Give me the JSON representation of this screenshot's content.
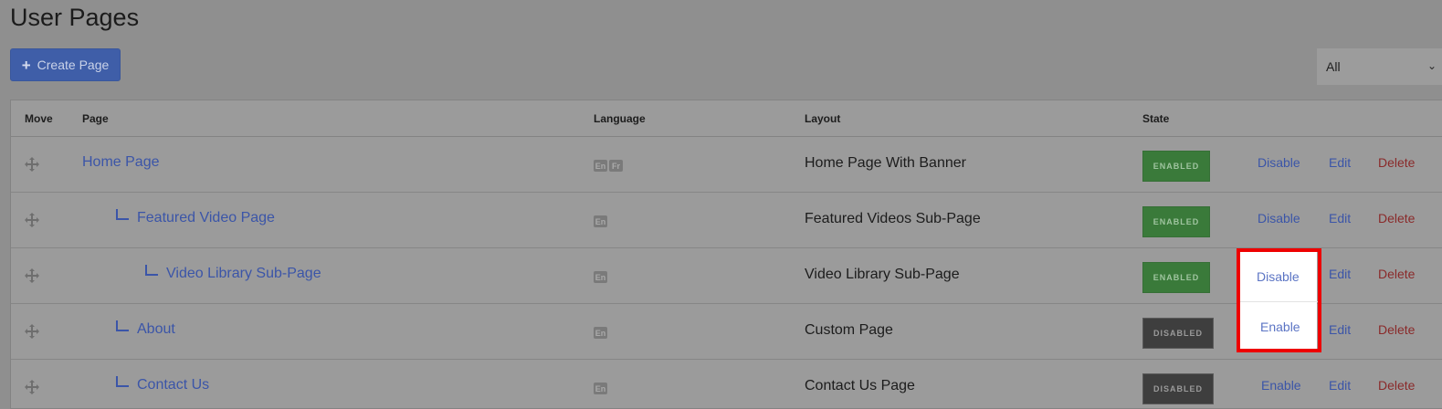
{
  "page": {
    "title": "User Pages",
    "create_button": "Create Page",
    "filter": {
      "selected": "All"
    }
  },
  "table": {
    "headers": {
      "move": "Move",
      "page": "Page",
      "language": "Language",
      "layout": "Layout",
      "state": "State"
    },
    "rows": [
      {
        "page": "Home Page",
        "languages": [
          "En",
          "Fr"
        ],
        "layout": "Home Page With Banner",
        "state": "ENABLED",
        "toggle": "Disable",
        "edit": "Edit",
        "delete": "Delete"
      },
      {
        "page": "Featured Video Page",
        "languages": [
          "En"
        ],
        "layout": "Featured Videos Sub-Page",
        "state": "ENABLED",
        "toggle": "Disable",
        "edit": "Edit",
        "delete": "Delete"
      },
      {
        "page": "Video Library Sub-Page",
        "languages": [
          "En"
        ],
        "layout": "Video Library Sub-Page",
        "state": "ENABLED",
        "toggle": "Disable",
        "edit": "Edit",
        "delete": "Delete"
      },
      {
        "page": "About",
        "languages": [
          "En"
        ],
        "layout": "Custom Page",
        "state": "DISABLED",
        "toggle": "Enable",
        "edit": "Edit",
        "delete": "Delete"
      },
      {
        "page": "Contact Us",
        "languages": [
          "En"
        ],
        "layout": "Contact Us Page",
        "state": "DISABLED",
        "toggle": "Enable",
        "edit": "Edit",
        "delete": "Delete"
      }
    ]
  },
  "icons": {
    "plus": "plus-icon",
    "move": "move-icon",
    "chevron": "chevron-down-icon"
  },
  "colors": {
    "accent": "#3b55a8",
    "enabled": "#3a7a3a",
    "disabled": "#3e3e3e",
    "delete": "#8a2a2a",
    "highlight": "#ee0000"
  }
}
